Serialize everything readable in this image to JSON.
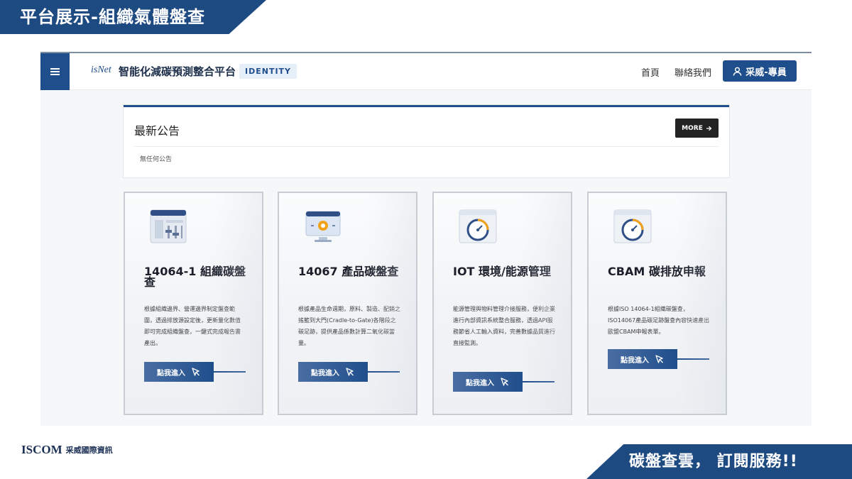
{
  "slide": {
    "title": "平台展示-組織氣體盤查",
    "slogan": "碳盤查雲， 訂閱服務!!",
    "brand_en": "ISCOM",
    "brand_zh": "采威國際資訊"
  },
  "header": {
    "logo": "isNet",
    "app_title": "智能化減碳預測整合平台",
    "identity_tag": "IDENTITY",
    "nav_home": "首頁",
    "nav_contact": "聯絡我們",
    "user_button": "采威-專員"
  },
  "announcement": {
    "title": "最新公告",
    "more_label": "MORE",
    "empty_text": "無任何公告"
  },
  "cards": [
    {
      "title": "14064-1 組織碳盤查",
      "description": "根據組織邊界、營運邊界制定盤查範圍，透過排放源設定後，更新量化數值即可完成組織盤查，一鍵式完成報告書產出。",
      "button": "點我進入"
    },
    {
      "title": "14067 產品碳盤查",
      "description": "根據產品生命週期，原料、製造、配銷之搖籃到大門(Cradle-to-Gate)各階段之碳足跡，提供產品係數計算二氧化碳當量。",
      "button": "點我進入"
    },
    {
      "title": "IOT 環境/能源管理",
      "description": "能源管理與物料管理介接服務，便利企業進行內部資訊系統整合服務，透過API服務節省人工輸入資料，完善數據品質進行直接監測。",
      "button": "點我進入"
    },
    {
      "title": "CBAM 碳排放申報",
      "description": "根據ISO 14064-1組織碳盤查，ISO14067產品碳足跡盤查內容快速產出歐盟CBAM申報表單。",
      "button": "點我進入"
    }
  ],
  "colors": {
    "brand_blue": "#1f4e8c",
    "banner_blue": "#1e4a82",
    "dark_button": "#222222"
  }
}
